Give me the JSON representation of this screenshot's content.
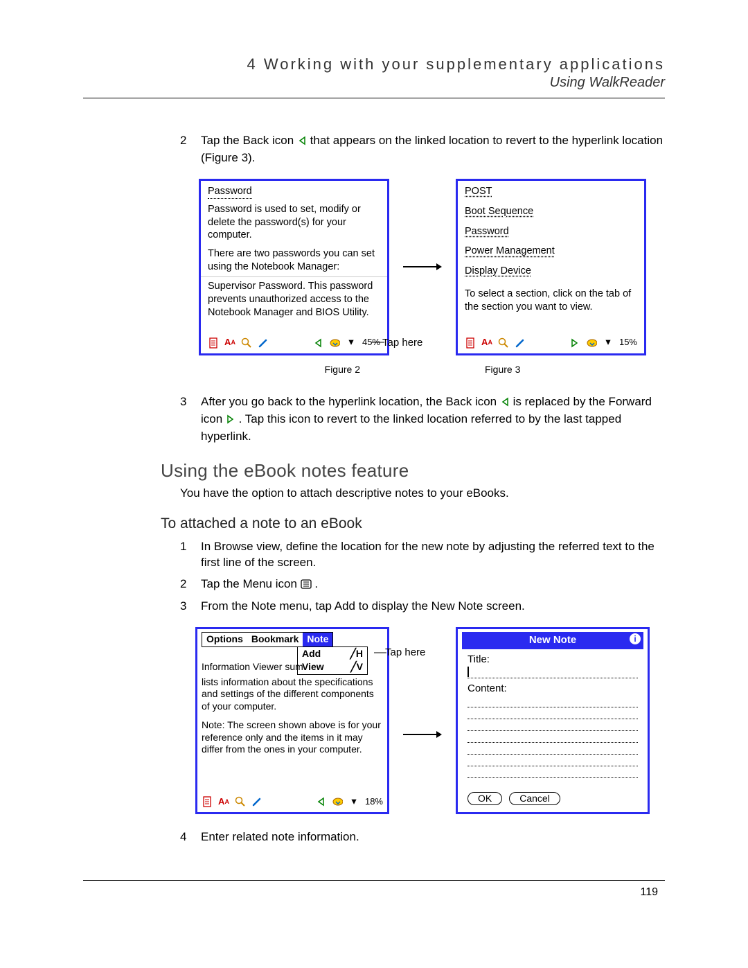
{
  "header": {
    "chapter": "4 Working with your supplementary applications",
    "section": "Using WalkReader"
  },
  "step2": {
    "num": "2",
    "pre": "Tap the Back icon ",
    "post": " that appears on the linked location to revert to the hyperlink location (Figure 3)."
  },
  "fig1": {
    "left_panel": {
      "title": "Password",
      "para1": "Password is used to set, modify or delete the password(s) for your computer.",
      "para2": "There are two passwords you can set using the Notebook Manager:",
      "para3": "Supervisor Password. This password prevents unauthorized access to the Notebook Manager and BIOS Utility.",
      "percent": "45%"
    },
    "tap_here": "Tap here",
    "right_panel": {
      "items": [
        "POST",
        "Boot Sequence",
        "Password",
        "Power Management",
        "Display Device"
      ],
      "footer": "To select a section, click on the tab of the section you want to view.",
      "percent": "15%"
    },
    "cap_left": "Figure 2",
    "cap_right": "Figure 3"
  },
  "step3": {
    "num": "3",
    "pre": "After you go back to the hyperlink location, the Back icon ",
    "mid": " is replaced by the Forward icon ",
    "post": ". Tap this icon to revert to the linked location referred to by the last tapped hyperlink."
  },
  "h2": "Using the eBook notes feature",
  "lead": "You have the option to attach descriptive notes to your eBooks.",
  "h3": "To attached a note to an eBook",
  "attach_steps": {
    "s1": {
      "num": "1",
      "text": "In Browse view, define the location for the new note by adjusting the referred text to the first line of the screen."
    },
    "s2": {
      "num": "2",
      "pre": "Tap the Menu icon ",
      "post": "."
    },
    "s3": {
      "num": "3",
      "text": "From the Note menu, tap Add to display the New Note screen."
    },
    "s4": {
      "num": "4",
      "text": "Enter related note information."
    }
  },
  "fig2": {
    "left_panel": {
      "menu": {
        "options": "Options",
        "bookmark": "Bookmark",
        "note": "Note"
      },
      "submenu": {
        "add": "Add",
        "add_sc": "╱H",
        "view": "View",
        "view_sc": "╱V"
      },
      "line1": "Information Viewer sum",
      "para1": "lists information about the specifications and settings of the different components of your computer.",
      "para2": "Note: The screen shown above is for your reference only and the items in it may differ from the ones in your computer.",
      "percent": "18%"
    },
    "tap_here": "Tap here",
    "right_panel": {
      "title": "New Note",
      "title_label": "Title:",
      "content_label": "Content:",
      "ok": "OK",
      "cancel": "Cancel"
    }
  },
  "page_num": "119"
}
